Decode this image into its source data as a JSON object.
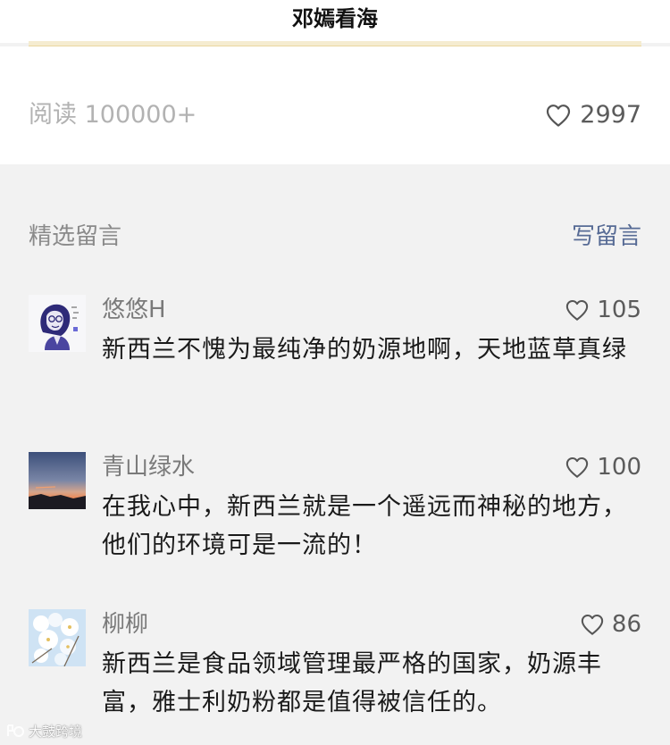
{
  "header": {
    "title": "邓嫣看海"
  },
  "stats": {
    "read_text": "阅读 100000+",
    "like_count": "2997",
    "like_icon": "heart-outline-icon"
  },
  "comments_section": {
    "title": "精选留言",
    "write_label": "写留言"
  },
  "comments": [
    {
      "name": "悠悠H",
      "likes": "105",
      "text": "新西兰不愧为最纯净的奶源地啊，天地蓝草真绿"
    },
    {
      "name": "青山绿水",
      "likes": "100",
      "text": "在我心中，新西兰就是一个遥远而神秘的地方，他们的环境可是一流的！"
    },
    {
      "name": "柳柳",
      "likes": "86",
      "text": "新西兰是食品领域管理最严格的国家，奶源丰富，雅士利奶粉都是值得被信任的。"
    }
  ],
  "watermark": {
    "text": "大鼓跨境"
  },
  "colors": {
    "link_blue": "#576b95",
    "muted_gray": "#b2b2b2",
    "page_gray": "#f2f2f2",
    "divider_gold": "#f5ecd0"
  }
}
